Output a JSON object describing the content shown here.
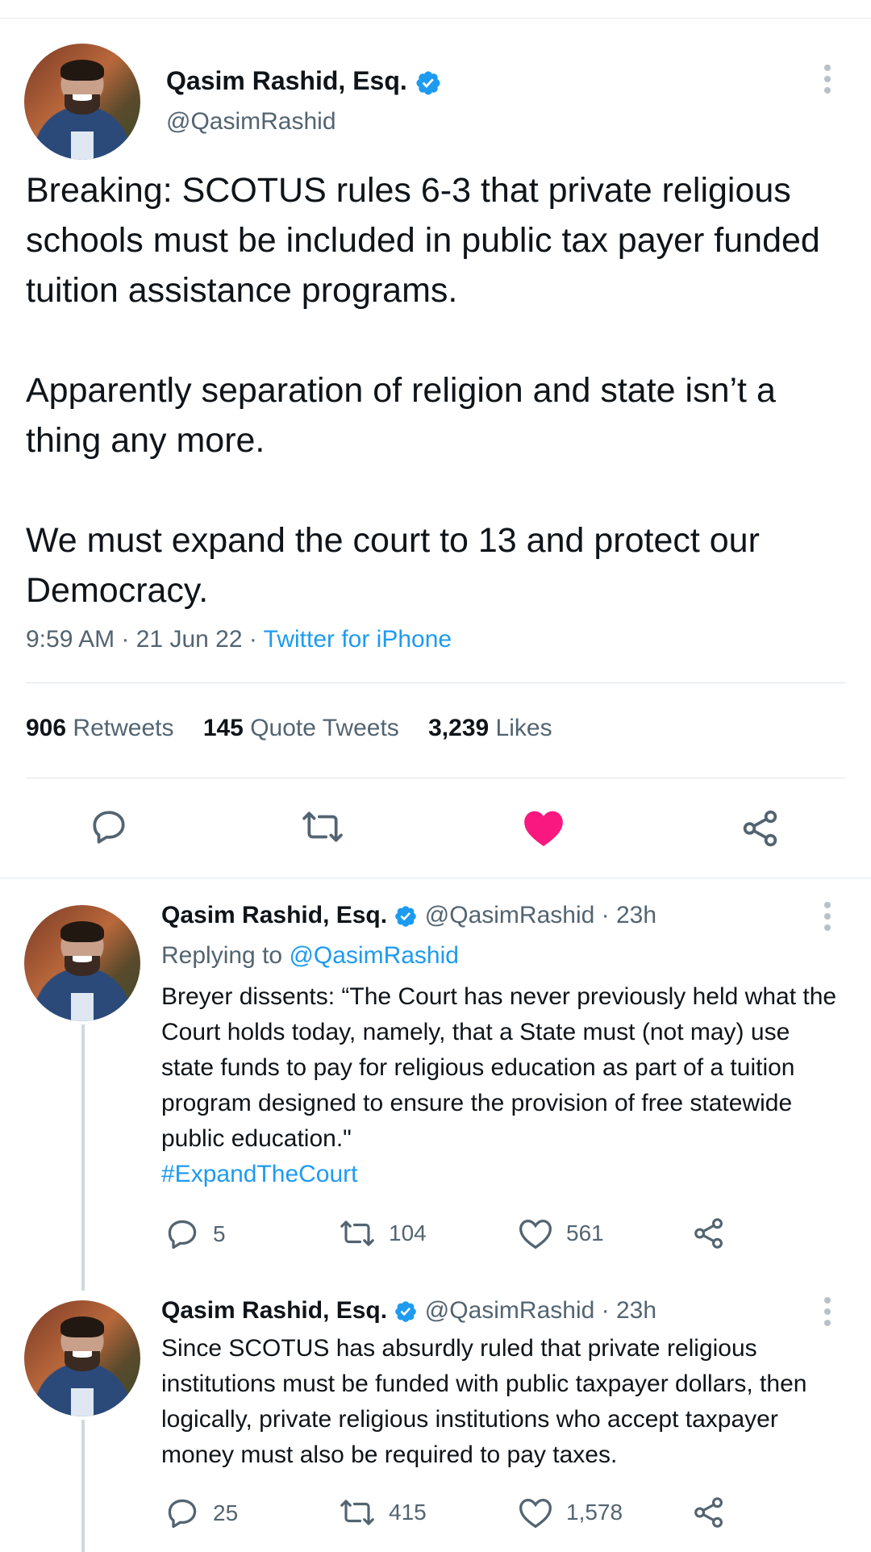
{
  "main_tweet": {
    "author_name": "Qasim Rashid, Esq.",
    "handle": "@QasimRashid",
    "paragraphs": [
      "Breaking: SCOTUS rules 6-3 that private religious schools must be included in public tax payer funded tuition assistance programs.",
      "Apparently separation of religion and state isn’t a thing any more.",
      "We must expand the court to 13 and protect our Democracy."
    ],
    "time": "9:59 AM",
    "date": "21 Jun 22",
    "source": "Twitter for iPhone",
    "stats": {
      "retweets_count": "906",
      "retweets_label": "Retweets",
      "quotes_count": "145",
      "quotes_label": "Quote Tweets",
      "likes_count": "3,239",
      "likes_label": "Likes"
    },
    "liked": true,
    "colors": {
      "like": "#f91880",
      "link": "#1d9bf0",
      "verified": "#1d9bf0"
    }
  },
  "replies": [
    {
      "author_name": "Qasim Rashid, Esq.",
      "handle": "@QasimRashid",
      "age": "23h",
      "replying_prefix": "Replying to",
      "replying_to": "@QasimRashid",
      "text": "Breyer dissents: “The Court has never previously held what the Court holds today, namely, that a State must (not may) use state funds to pay for religious education as part of a tuition program designed to ensure the provision of free statewide public education.\"",
      "hashtag": "#ExpandTheCourt",
      "replies_count": "5",
      "retweets_count": "104",
      "likes_count": "561"
    },
    {
      "author_name": "Qasim Rashid, Esq.",
      "handle": "@QasimRashid",
      "age": "23h",
      "text": "Since SCOTUS has absurdly ruled that private religious institutions must be funded with public taxpayer dollars, then logically, private religious institutions who accept taxpayer money must also be required to pay taxes.",
      "replies_count": "25",
      "retweets_count": "415",
      "likes_count": "1,578"
    }
  ]
}
